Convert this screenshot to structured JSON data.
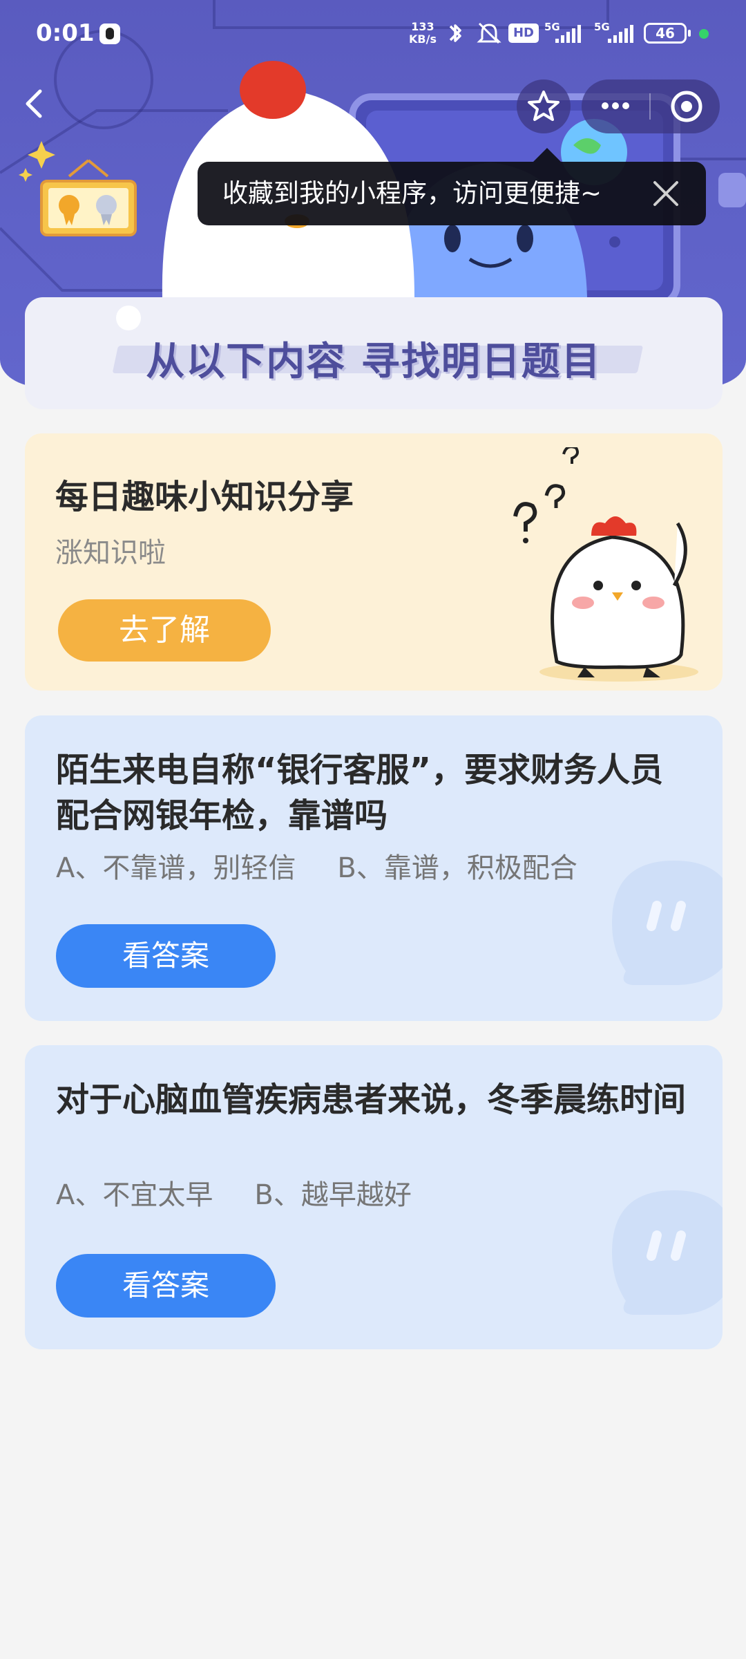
{
  "status_bar": {
    "time": "0:01",
    "net_speed_value": "133",
    "net_speed_unit": "KB/s",
    "hd_label": "HD",
    "signal_label_1": "5G",
    "signal_label_2": "5G",
    "battery": "46"
  },
  "nav": {
    "back_icon": "chevron-left-icon",
    "star_icon": "star-outline-icon",
    "more_icon": "more-dots-icon",
    "target_icon": "target-circle-icon"
  },
  "tooltip": {
    "text": "收藏到我的小程序，访问更便捷~",
    "close_icon": "close-icon"
  },
  "sub_banner": {
    "title": "从以下内容  寻找明日题目"
  },
  "info_card": {
    "title": "每日趣味小知识分享",
    "subtitle": "涨知识啦",
    "button_label": "去了解"
  },
  "questions": [
    {
      "title": "陌生来电自称“银行客服”，要求财务人员配合网银年检，靠谱吗",
      "option_a": "A、不靠谱，别轻信",
      "option_b": "B、靠谱，积极配合",
      "button_label": "看答案"
    },
    {
      "title": "对于心脑血管疾病患者来说，冬季晨练时间",
      "option_a": "A、不宜太早",
      "option_b": "B、越早越好",
      "button_label": "看答案"
    }
  ],
  "colors": {
    "header_bg": "#5f62c8",
    "info_card_bg": "#fdf1d7",
    "question_card_bg": "#dde9fb",
    "orange_button": "#f5b242",
    "blue_button": "#3a86f5"
  }
}
